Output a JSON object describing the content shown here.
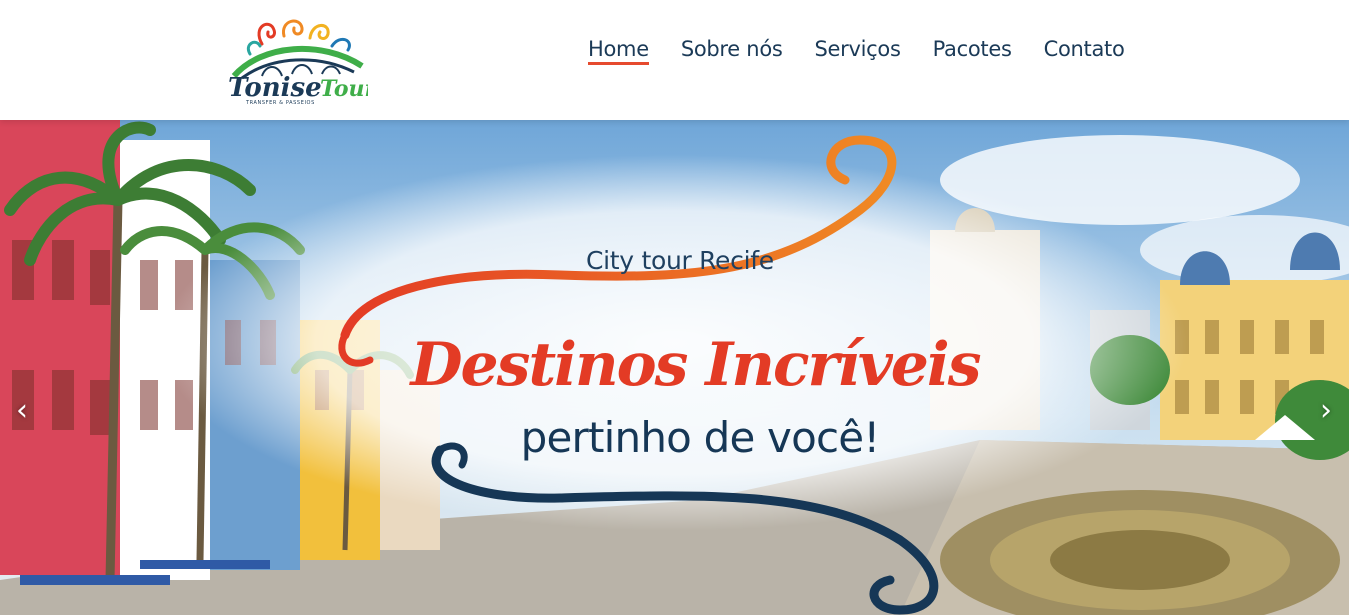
{
  "brand": {
    "name": "Tonise Tour",
    "name_part1": "Tonise",
    "name_part2": "Tour",
    "tagline": "TRANSFER & PASSEIOS",
    "colors": {
      "navy": "#1b3a57",
      "green": "#3fae49",
      "orange": "#f08a24",
      "red": "#e33b25"
    }
  },
  "nav": {
    "items": [
      {
        "label": "Home",
        "active": true
      },
      {
        "label": "Sobre nós",
        "active": false
      },
      {
        "label": "Serviços",
        "active": false
      },
      {
        "label": "Pacotes",
        "active": false
      },
      {
        "label": "Contato",
        "active": false
      }
    ],
    "active_underline_color": "#e64a2e"
  },
  "hero": {
    "kicker": "City tour Recife",
    "title": "Destinos Incríveis",
    "subtitle": "pertinho de você!",
    "prev_icon": "chevron-left-icon",
    "next_icon": "chevron-right-icon",
    "prev_glyph": "‹",
    "next_glyph": "›"
  }
}
